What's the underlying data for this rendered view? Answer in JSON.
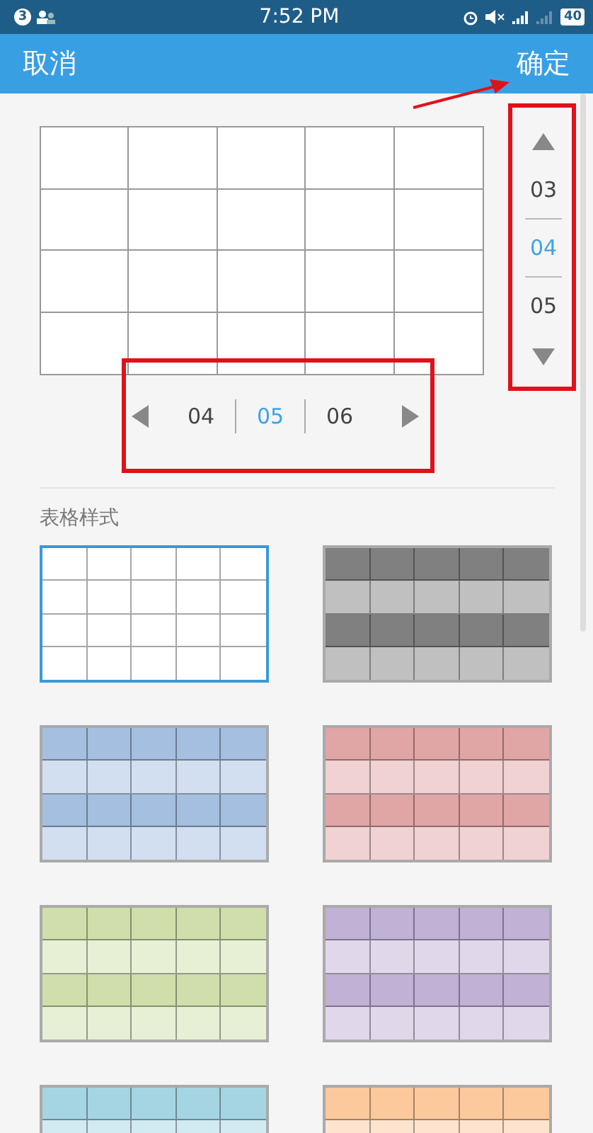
{
  "status_bar": {
    "notification_count": "3",
    "time": "7:52 PM",
    "battery": "40"
  },
  "app_bar": {
    "cancel": "取消",
    "confirm": "确定"
  },
  "row_picker": {
    "options": [
      {
        "label": "03",
        "selected": false
      },
      {
        "label": "04",
        "selected": true
      },
      {
        "label": "05",
        "selected": false
      }
    ]
  },
  "column_picker": {
    "options": [
      {
        "label": "04",
        "selected": false
      },
      {
        "label": "05",
        "selected": true
      },
      {
        "label": "06",
        "selected": false
      }
    ]
  },
  "styles_section": {
    "title": "表格样式"
  },
  "styles": [
    {
      "color": "#ffffff",
      "selected": true
    },
    {
      "color": "#808080",
      "selected": false
    },
    {
      "color": "#a4bfe0",
      "selected": false
    },
    {
      "color": "#e0a5a5",
      "selected": false
    },
    {
      "color": "#cfdeaa",
      "selected": false
    },
    {
      "color": "#c1b1d5",
      "selected": false
    },
    {
      "color": "#a5d5e3",
      "selected": false
    },
    {
      "color": "#fcc99c",
      "selected": false
    }
  ]
}
